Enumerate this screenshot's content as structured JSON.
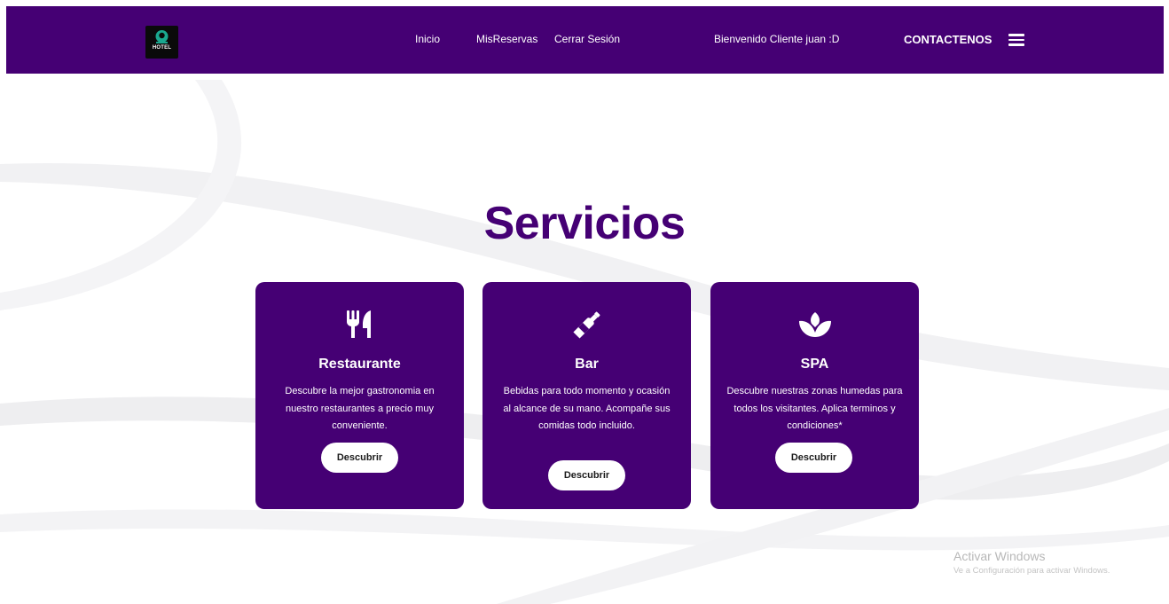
{
  "header": {
    "logo_text": "HOTEL",
    "nav": {
      "home": "Inicio",
      "reservations": "MisReservas",
      "logout": "Cerrar Sesión"
    },
    "welcome": "Bienvenido Cliente juan :D",
    "contact": "CONTACTENOS"
  },
  "main": {
    "title": "Servicios",
    "cards": [
      {
        "icon": "utensils-icon",
        "title": "Restaurante",
        "description": "Descubre la mejor gastronomia en nuestro restaurantes a precio muy conveniente.",
        "button": "Descubrir"
      },
      {
        "icon": "bottle-icon",
        "title": "Bar",
        "description": "Bebidas para todo momento y ocasión al alcance de su mano. Acompañe sus comidas todo incluido.",
        "button": "Descubrir"
      },
      {
        "icon": "spa-lotus-icon",
        "title": "SPA",
        "description": "Descubre nuestras zonas humedas para todos los visitantes. Aplica terminos y condiciones*",
        "button": "Descubrir"
      }
    ]
  },
  "watermark": {
    "title": "Activar Windows",
    "subtitle": "Ve a Configuración para activar Windows."
  },
  "colors": {
    "brand_purple": "#450074",
    "button_bg": "#ffffff",
    "background": "#ffffff"
  }
}
